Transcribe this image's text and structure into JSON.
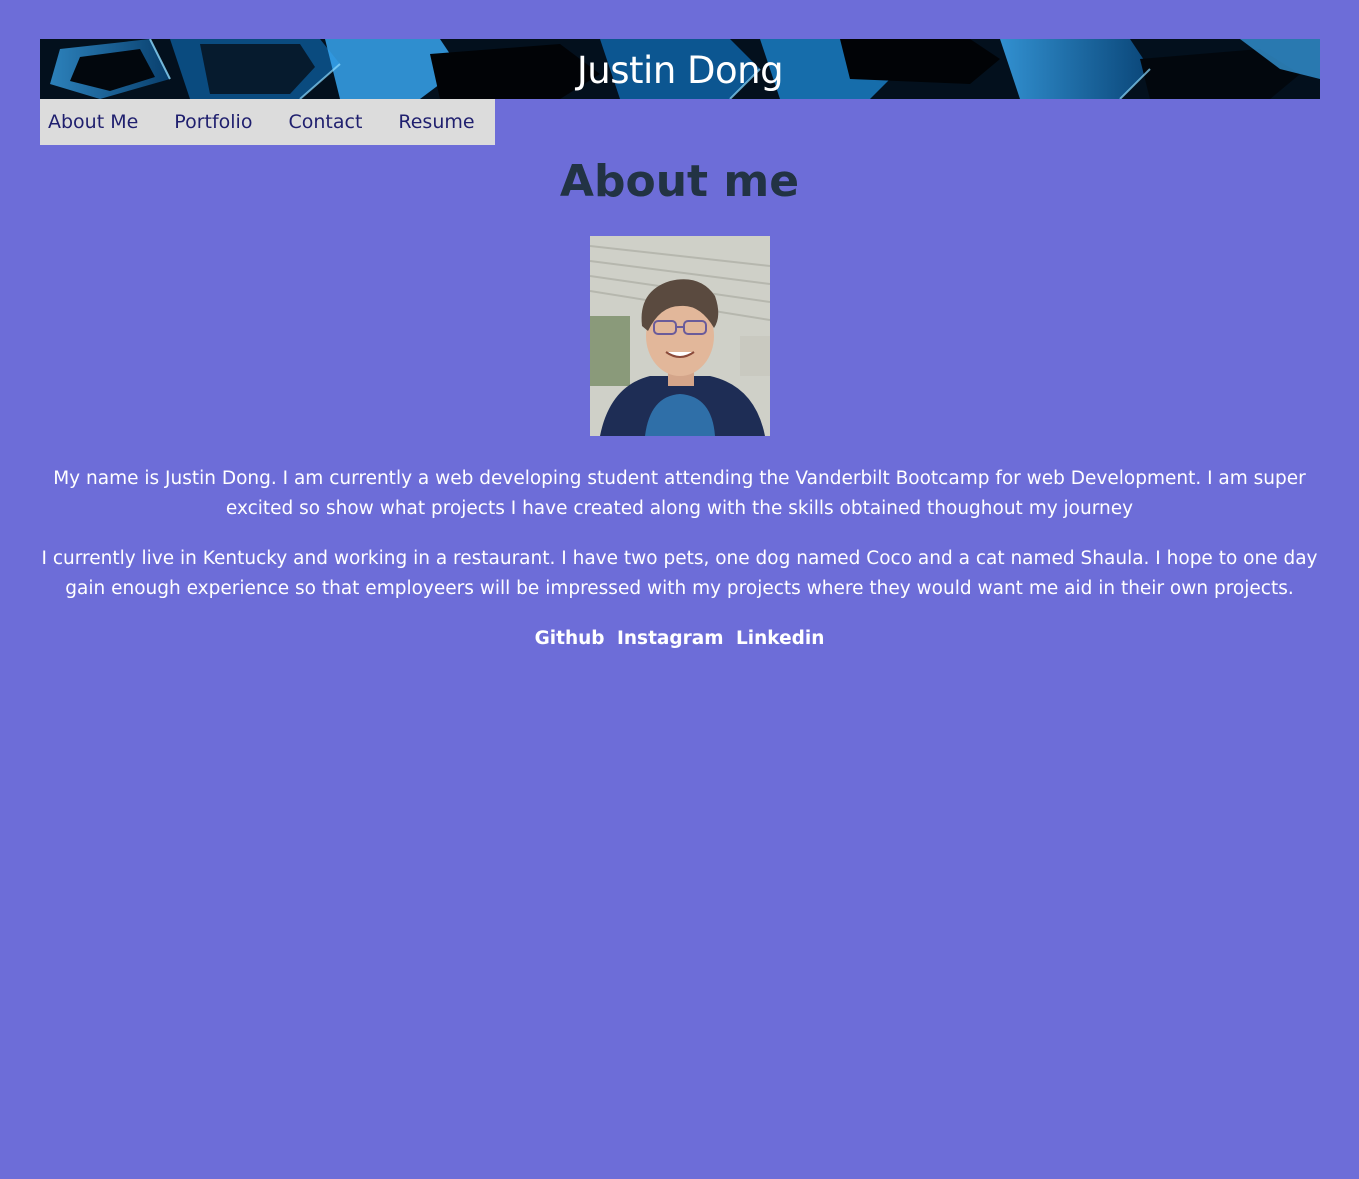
{
  "header": {
    "title": "Justin Dong"
  },
  "nav": {
    "items": [
      {
        "label": "About Me"
      },
      {
        "label": "Portfolio"
      },
      {
        "label": "Contact"
      },
      {
        "label": "Resume"
      }
    ]
  },
  "main": {
    "heading": "About me",
    "paragraphs": [
      "My name is Justin Dong. I am currently a web developing student attending the Vanderbilt Bootcamp for web Development. I am super excited so show what projects I have created along with the skills obtained thoughout my journey",
      "I currently live in Kentucky and working in a restaurant. I have two pets, one dog named Coco and a cat named Shaula. I hope to one day gain enough experience so that employeers will be impressed with my projects where they would want me aid in their own projects."
    ],
    "links": [
      {
        "label": "Github"
      },
      {
        "label": "Instagram"
      },
      {
        "label": "Linkedin"
      }
    ]
  },
  "colors": {
    "background": "#6d6dd8",
    "nav_background": "#dcdcdc",
    "nav_text": "#1f1f6e",
    "heading": "#223344",
    "body_text": "#ffffff"
  }
}
